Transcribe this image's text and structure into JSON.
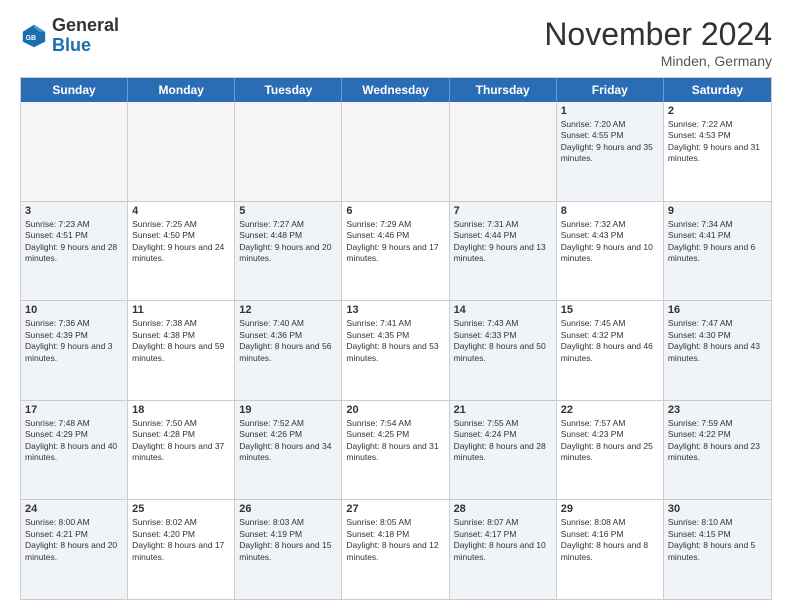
{
  "header": {
    "logo_general": "General",
    "logo_blue": "Blue",
    "month_title": "November 2024",
    "subtitle": "Minden, Germany"
  },
  "calendar": {
    "days": [
      "Sunday",
      "Monday",
      "Tuesday",
      "Wednesday",
      "Thursday",
      "Friday",
      "Saturday"
    ],
    "rows": [
      [
        {
          "day": "",
          "text": "",
          "empty": true
        },
        {
          "day": "",
          "text": "",
          "empty": true
        },
        {
          "day": "",
          "text": "",
          "empty": true
        },
        {
          "day": "",
          "text": "",
          "empty": true
        },
        {
          "day": "",
          "text": "",
          "empty": true
        },
        {
          "day": "1",
          "text": "Sunrise: 7:20 AM\nSunset: 4:55 PM\nDaylight: 9 hours and 35 minutes.",
          "empty": false,
          "shaded": true
        },
        {
          "day": "2",
          "text": "Sunrise: 7:22 AM\nSunset: 4:53 PM\nDaylight: 9 hours and 31 minutes.",
          "empty": false,
          "shaded": false
        }
      ],
      [
        {
          "day": "3",
          "text": "Sunrise: 7:23 AM\nSunset: 4:51 PM\nDaylight: 9 hours and 28 minutes.",
          "empty": false,
          "shaded": true
        },
        {
          "day": "4",
          "text": "Sunrise: 7:25 AM\nSunset: 4:50 PM\nDaylight: 9 hours and 24 minutes.",
          "empty": false,
          "shaded": false
        },
        {
          "day": "5",
          "text": "Sunrise: 7:27 AM\nSunset: 4:48 PM\nDaylight: 9 hours and 20 minutes.",
          "empty": false,
          "shaded": true
        },
        {
          "day": "6",
          "text": "Sunrise: 7:29 AM\nSunset: 4:46 PM\nDaylight: 9 hours and 17 minutes.",
          "empty": false,
          "shaded": false
        },
        {
          "day": "7",
          "text": "Sunrise: 7:31 AM\nSunset: 4:44 PM\nDaylight: 9 hours and 13 minutes.",
          "empty": false,
          "shaded": true
        },
        {
          "day": "8",
          "text": "Sunrise: 7:32 AM\nSunset: 4:43 PM\nDaylight: 9 hours and 10 minutes.",
          "empty": false,
          "shaded": false
        },
        {
          "day": "9",
          "text": "Sunrise: 7:34 AM\nSunset: 4:41 PM\nDaylight: 9 hours and 6 minutes.",
          "empty": false,
          "shaded": true
        }
      ],
      [
        {
          "day": "10",
          "text": "Sunrise: 7:36 AM\nSunset: 4:39 PM\nDaylight: 9 hours and 3 minutes.",
          "empty": false,
          "shaded": true
        },
        {
          "day": "11",
          "text": "Sunrise: 7:38 AM\nSunset: 4:38 PM\nDaylight: 8 hours and 59 minutes.",
          "empty": false,
          "shaded": false
        },
        {
          "day": "12",
          "text": "Sunrise: 7:40 AM\nSunset: 4:36 PM\nDaylight: 8 hours and 56 minutes.",
          "empty": false,
          "shaded": true
        },
        {
          "day": "13",
          "text": "Sunrise: 7:41 AM\nSunset: 4:35 PM\nDaylight: 8 hours and 53 minutes.",
          "empty": false,
          "shaded": false
        },
        {
          "day": "14",
          "text": "Sunrise: 7:43 AM\nSunset: 4:33 PM\nDaylight: 8 hours and 50 minutes.",
          "empty": false,
          "shaded": true
        },
        {
          "day": "15",
          "text": "Sunrise: 7:45 AM\nSunset: 4:32 PM\nDaylight: 8 hours and 46 minutes.",
          "empty": false,
          "shaded": false
        },
        {
          "day": "16",
          "text": "Sunrise: 7:47 AM\nSunset: 4:30 PM\nDaylight: 8 hours and 43 minutes.",
          "empty": false,
          "shaded": true
        }
      ],
      [
        {
          "day": "17",
          "text": "Sunrise: 7:48 AM\nSunset: 4:29 PM\nDaylight: 8 hours and 40 minutes.",
          "empty": false,
          "shaded": true
        },
        {
          "day": "18",
          "text": "Sunrise: 7:50 AM\nSunset: 4:28 PM\nDaylight: 8 hours and 37 minutes.",
          "empty": false,
          "shaded": false
        },
        {
          "day": "19",
          "text": "Sunrise: 7:52 AM\nSunset: 4:26 PM\nDaylight: 8 hours and 34 minutes.",
          "empty": false,
          "shaded": true
        },
        {
          "day": "20",
          "text": "Sunrise: 7:54 AM\nSunset: 4:25 PM\nDaylight: 8 hours and 31 minutes.",
          "empty": false,
          "shaded": false
        },
        {
          "day": "21",
          "text": "Sunrise: 7:55 AM\nSunset: 4:24 PM\nDaylight: 8 hours and 28 minutes.",
          "empty": false,
          "shaded": true
        },
        {
          "day": "22",
          "text": "Sunrise: 7:57 AM\nSunset: 4:23 PM\nDaylight: 8 hours and 25 minutes.",
          "empty": false,
          "shaded": false
        },
        {
          "day": "23",
          "text": "Sunrise: 7:59 AM\nSunset: 4:22 PM\nDaylight: 8 hours and 23 minutes.",
          "empty": false,
          "shaded": true
        }
      ],
      [
        {
          "day": "24",
          "text": "Sunrise: 8:00 AM\nSunset: 4:21 PM\nDaylight: 8 hours and 20 minutes.",
          "empty": false,
          "shaded": true
        },
        {
          "day": "25",
          "text": "Sunrise: 8:02 AM\nSunset: 4:20 PM\nDaylight: 8 hours and 17 minutes.",
          "empty": false,
          "shaded": false
        },
        {
          "day": "26",
          "text": "Sunrise: 8:03 AM\nSunset: 4:19 PM\nDaylight: 8 hours and 15 minutes.",
          "empty": false,
          "shaded": true
        },
        {
          "day": "27",
          "text": "Sunrise: 8:05 AM\nSunset: 4:18 PM\nDaylight: 8 hours and 12 minutes.",
          "empty": false,
          "shaded": false
        },
        {
          "day": "28",
          "text": "Sunrise: 8:07 AM\nSunset: 4:17 PM\nDaylight: 8 hours and 10 minutes.",
          "empty": false,
          "shaded": true
        },
        {
          "day": "29",
          "text": "Sunrise: 8:08 AM\nSunset: 4:16 PM\nDaylight: 8 hours and 8 minutes.",
          "empty": false,
          "shaded": false
        },
        {
          "day": "30",
          "text": "Sunrise: 8:10 AM\nSunset: 4:15 PM\nDaylight: 8 hours and 5 minutes.",
          "empty": false,
          "shaded": true
        }
      ]
    ]
  }
}
